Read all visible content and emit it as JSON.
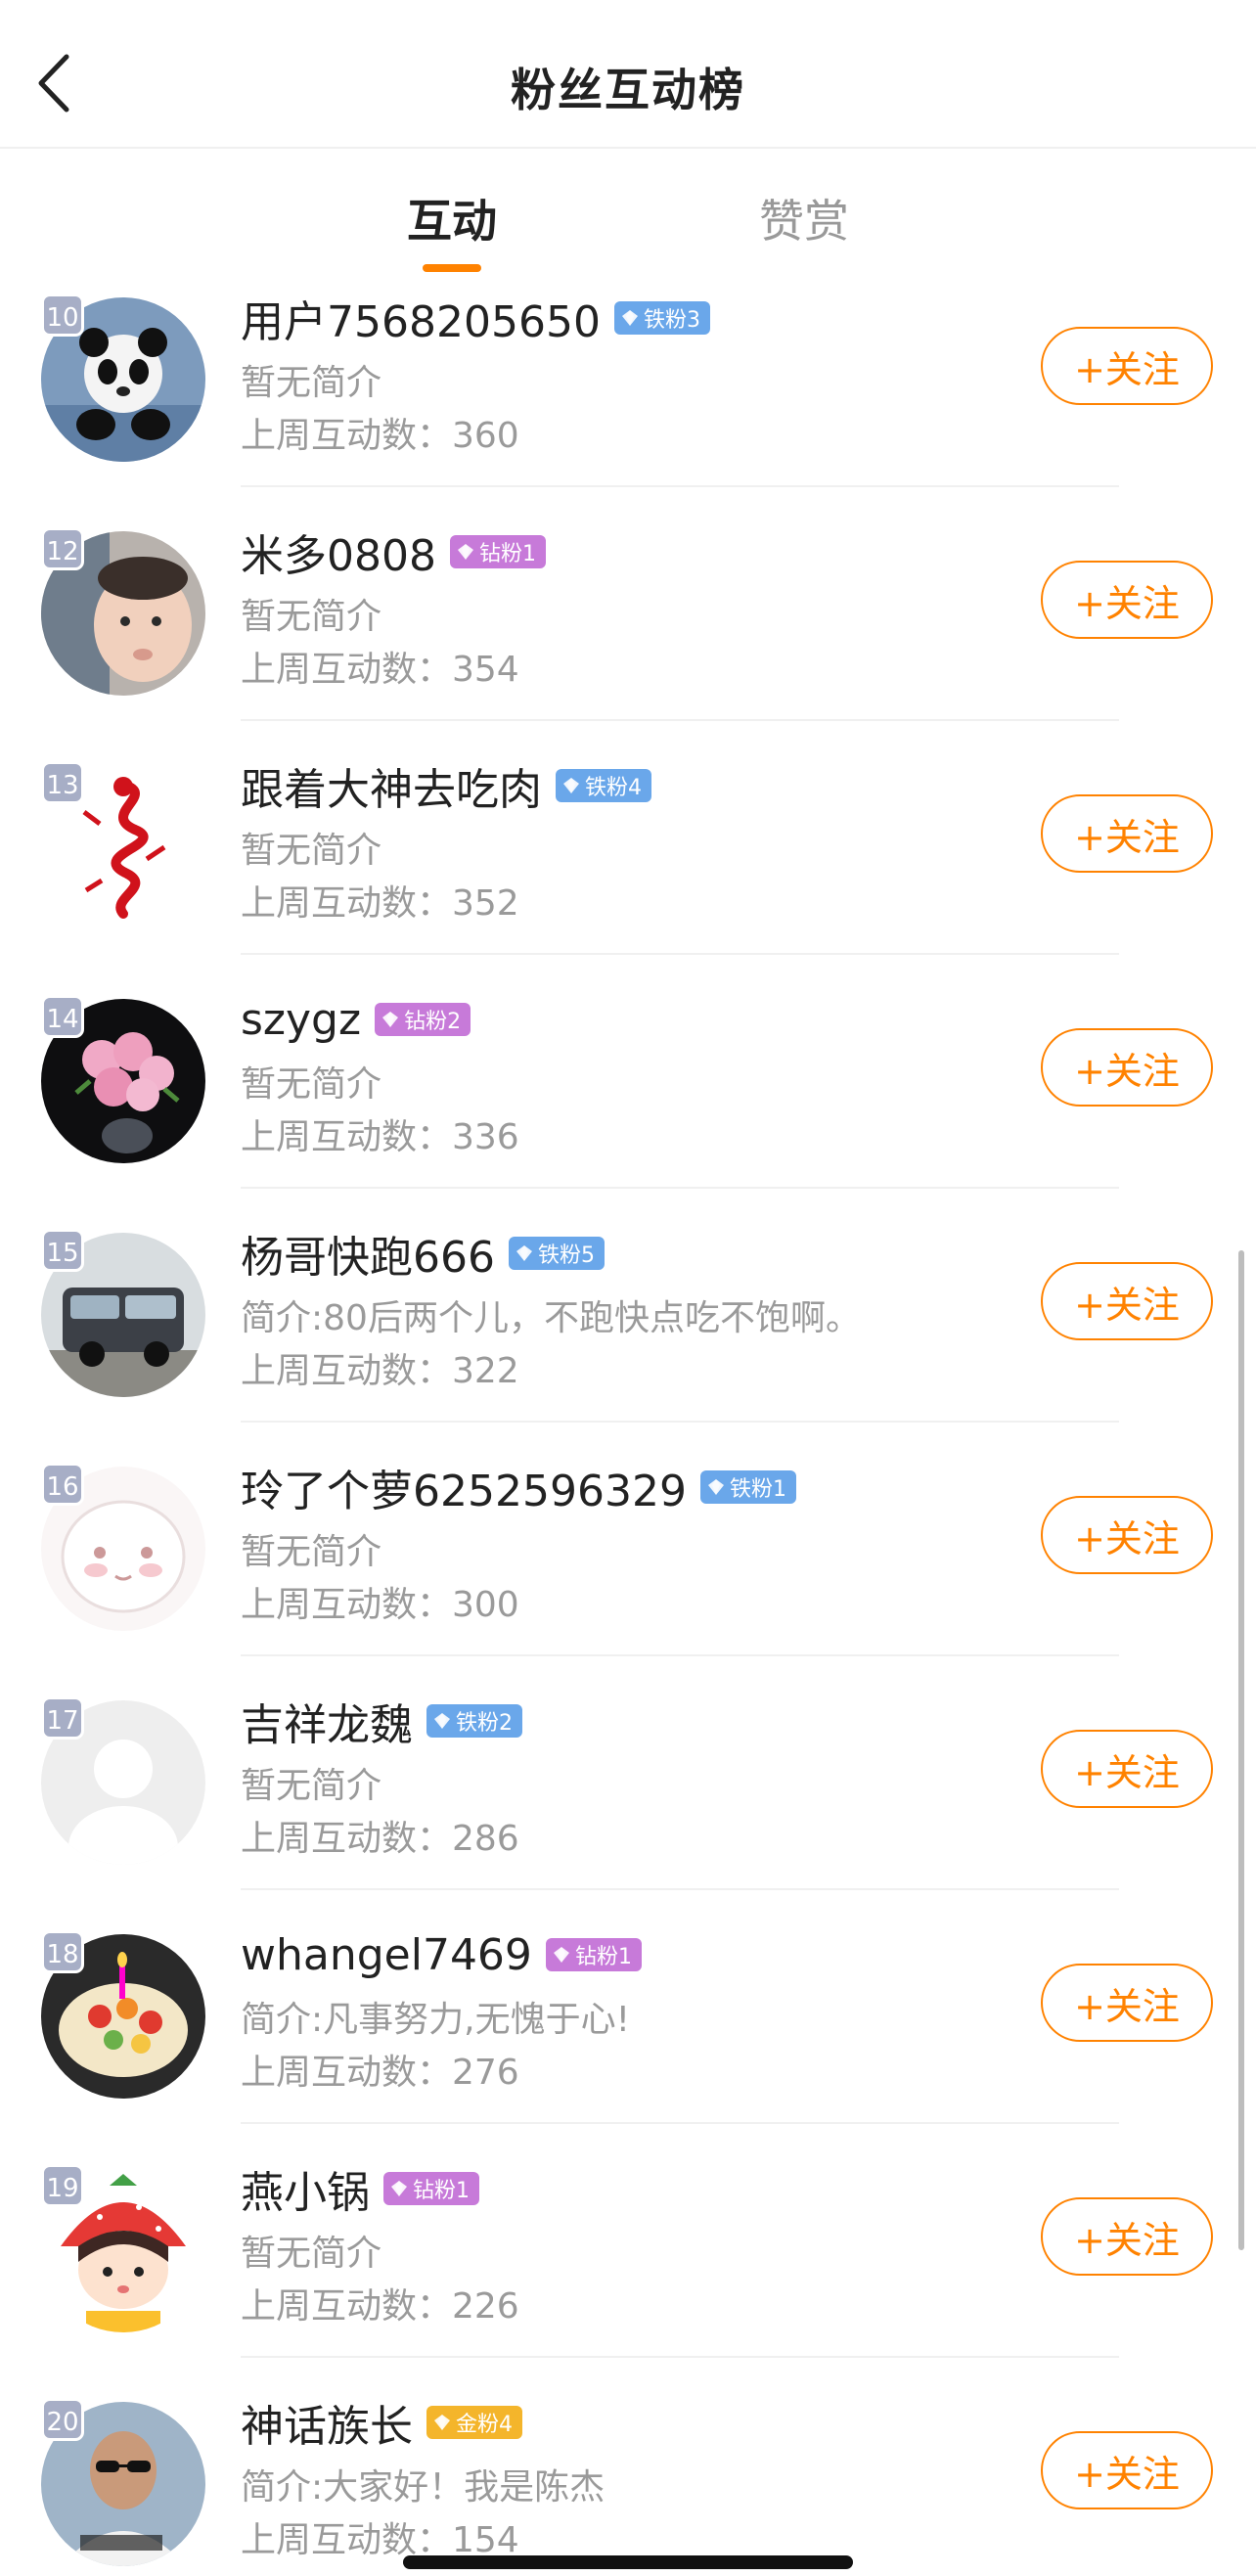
{
  "header": {
    "title": "粉丝互动榜",
    "back_icon": "chevron-left-icon"
  },
  "tabs": [
    {
      "label": "互动",
      "active": true
    },
    {
      "label": "赞赏",
      "active": false
    }
  ],
  "colors": {
    "accent": "#ff8200",
    "iron_badge": "#6aa7ea",
    "diamond_badge": "#c77ad9",
    "gold_badge": "#f4b52b",
    "rank_badge": "#a7aec6"
  },
  "follow_label": "+关注",
  "fans": [
    {
      "rank": "10",
      "name": "用户7568205650",
      "badge": "铁粉3",
      "badge_type": "iron",
      "bio": "暂无简介",
      "count": "上周互动数：360",
      "avatar": "panda-avatar"
    },
    {
      "rank": "12",
      "name": "米多0808",
      "badge": "钻粉1",
      "badge_type": "diamond",
      "bio": "暂无简介",
      "count": "上周互动数：354",
      "avatar": "baby-avatar"
    },
    {
      "rank": "13",
      "name": "跟着大神去吃肉",
      "badge": "铁粉4",
      "badge_type": "iron",
      "bio": "暂无简介",
      "count": "上周互动数：352",
      "avatar": "red-dragon-avatar"
    },
    {
      "rank": "14",
      "name": "szygz",
      "badge": "钻粉2",
      "badge_type": "diamond",
      "bio": "暂无简介",
      "count": "上周互动数：336",
      "avatar": "pink-roses-avatar"
    },
    {
      "rank": "15",
      "name": "杨哥快跑666",
      "badge": "铁粉5",
      "badge_type": "iron",
      "bio": "简介:80后两个儿，不跑快点吃不饱啊。",
      "count": "上周互动数：322",
      "avatar": "camper-van-avatar"
    },
    {
      "rank": "16",
      "name": "玲了个萝6252596329",
      "badge": "铁粉1",
      "badge_type": "iron",
      "bio": "暂无简介",
      "count": "上周互动数：300",
      "avatar": "cartoon-face-avatar"
    },
    {
      "rank": "17",
      "name": "吉祥龙魏",
      "badge": "铁粉2",
      "badge_type": "iron",
      "bio": "暂无简介",
      "count": "上周互动数：286",
      "avatar": "default-avatar"
    },
    {
      "rank": "18",
      "name": "whangel7469",
      "badge": "钻粉1",
      "badge_type": "diamond",
      "bio": "简介:凡事努力,无愧于心!",
      "count": "上周互动数：276",
      "avatar": "cake-avatar"
    },
    {
      "rank": "19",
      "name": "燕小锅",
      "badge": "钻粉1",
      "badge_type": "diamond",
      "bio": "暂无简介",
      "count": "上周互动数：226",
      "avatar": "strawberry-girl-avatar"
    },
    {
      "rank": "20",
      "name": "神话族长",
      "badge": "金粉4",
      "badge_type": "gold",
      "bio": "简介:大家好！我是陈杰",
      "count": "上周互动数：154",
      "avatar": "man-sunglasses-avatar"
    }
  ]
}
